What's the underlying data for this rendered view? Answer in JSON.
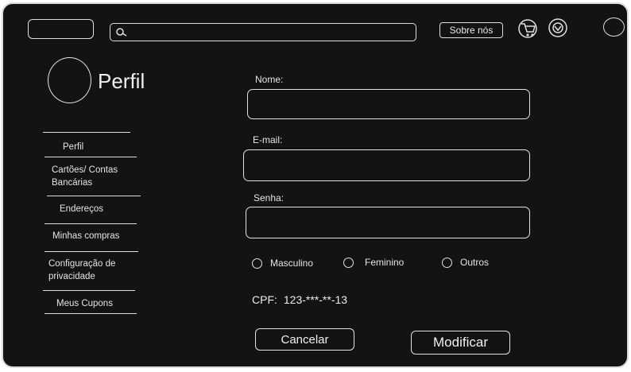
{
  "header": {
    "search": {
      "value": "",
      "placeholder": ""
    },
    "about_label": "Sobre nós"
  },
  "profile": {
    "title": "Perfil"
  },
  "sidebar": {
    "items": [
      {
        "label": "Perfil"
      },
      {
        "label": "Cartões/ Contas Bancárias"
      },
      {
        "label": "Endereços"
      },
      {
        "label": "Minhas compras"
      },
      {
        "label": "Configuração de privacidade"
      },
      {
        "label": "Meus Cupons"
      }
    ]
  },
  "form": {
    "name_label": "Nome:",
    "name_value": "",
    "email_label": "E-mail:",
    "email_value": "",
    "password_label": "Senha:",
    "password_value": "",
    "gender_options": [
      {
        "label": "Masculino"
      },
      {
        "label": "Feminino"
      },
      {
        "label": "Outros"
      }
    ],
    "cpf_label": "CPF:",
    "cpf_value": "123-***-**-13",
    "cancel_label": "Cancelar",
    "modify_label": "Modificar"
  },
  "icons": {
    "search": "search-icon",
    "cart": "cart-icon",
    "user": "user-icon",
    "menu": "circle-menu-icon"
  },
  "colors": {
    "background": "#131313",
    "stroke": "#e0e0e0",
    "text": "#e8e8e8"
  }
}
